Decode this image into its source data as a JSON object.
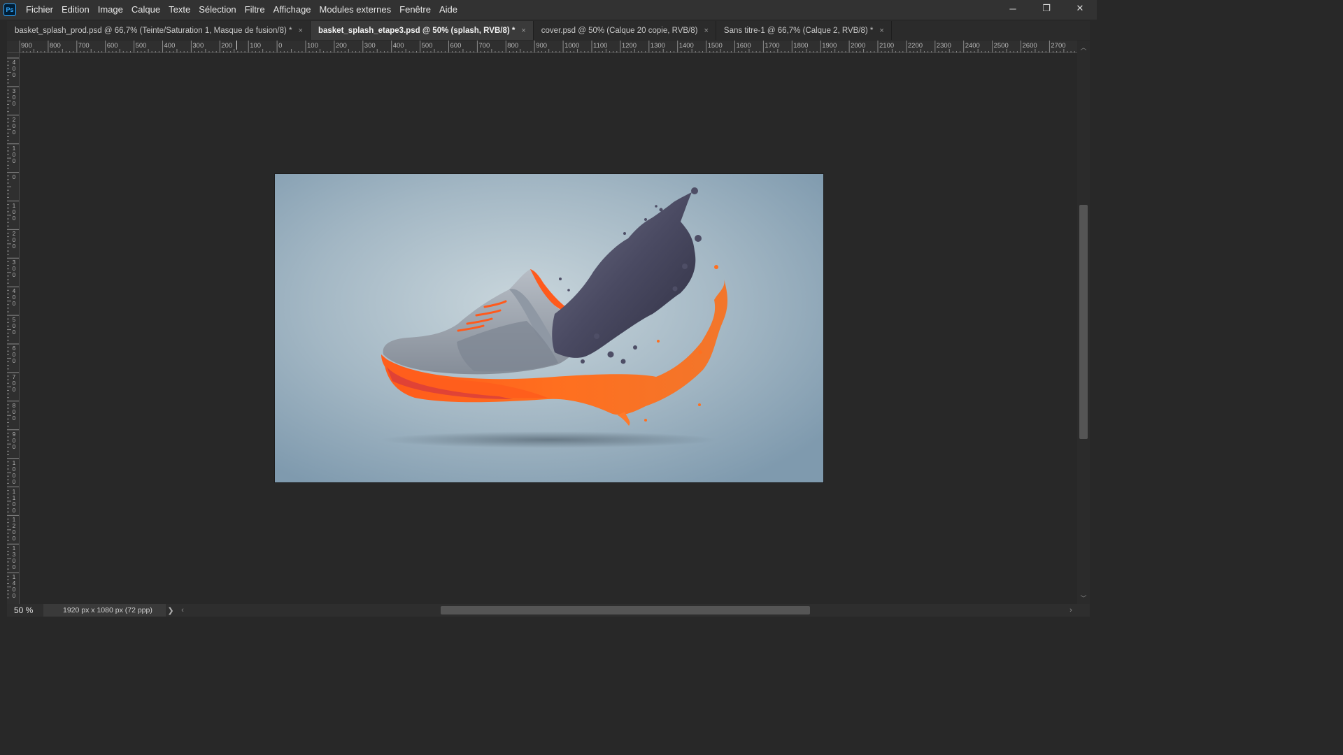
{
  "app": {
    "logo_text": "Ps"
  },
  "menu": [
    "Fichier",
    "Edition",
    "Image",
    "Calque",
    "Texte",
    "Sélection",
    "Filtre",
    "Affichage",
    "Modules externes",
    "Fenêtre",
    "Aide"
  ],
  "window_controls": {
    "minimize": "─",
    "restore": "❐",
    "close": "✕"
  },
  "tabs": [
    {
      "label": "basket_splash_prod.psd @ 66,7% (Teinte/Saturation 1, Masque de fusion/8) *",
      "close": "×",
      "active": false
    },
    {
      "label": "basket_splash_etape3.psd @ 50% (splash, RVB/8) *",
      "close": "×",
      "active": true
    },
    {
      "label": "cover.psd @ 50% (Calque 20 copie, RVB/8)",
      "close": "×",
      "active": false
    },
    {
      "label": "Sans titre-1 @ 66,7% (Calque 2, RVB/8) *",
      "close": "×",
      "active": false
    }
  ],
  "ruler_h": [
    "900",
    "800",
    "700",
    "600",
    "500",
    "400",
    "300",
    "200",
    "100",
    "0",
    "100",
    "200",
    "300",
    "400",
    "500",
    "600",
    "700",
    "800",
    "900",
    "1000",
    "1100",
    "1200",
    "1300",
    "1400",
    "1500",
    "1600",
    "1700",
    "1800",
    "1900",
    "2000",
    "2100",
    "2200",
    "2300",
    "2400",
    "2500",
    "2600",
    "2700"
  ],
  "ruler_v": [
    "400",
    "300",
    "200",
    "100",
    "0",
    "100",
    "200",
    "300",
    "400",
    "500",
    "600",
    "700",
    "800",
    "900",
    "1000",
    "1100",
    "1200",
    "1300",
    "1400"
  ],
  "canvas": {
    "background_center": "#c9d6dc",
    "background_edge": "#7f9aae",
    "shoe_upper": "#9aa2ac",
    "shoe_sole": "#ff6a1a",
    "splash_purple": "#4a4a62",
    "splash_orange": "#ff6f1f"
  },
  "status": {
    "zoom": "50 %",
    "doc_info": "1920 px x 1080 px (72 ppp)",
    "arrow": "❯"
  },
  "scroll": {
    "up": "︿",
    "down": "﹀",
    "left": "‹",
    "right": "›"
  }
}
